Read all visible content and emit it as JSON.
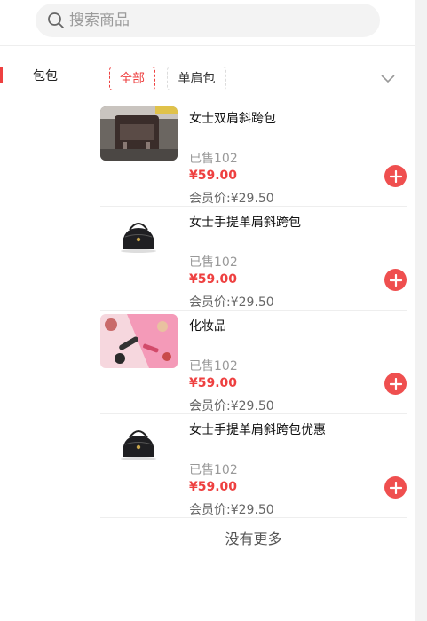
{
  "search": {
    "placeholder": "搜索商品"
  },
  "sidebar": {
    "items": [
      {
        "label": "包包",
        "active": true
      }
    ]
  },
  "filters": {
    "chips": [
      {
        "label": "全部",
        "active": true
      },
      {
        "label": "单肩包",
        "active": false
      }
    ]
  },
  "products": [
    {
      "title": "女士双肩斜跨包",
      "sold": "已售102",
      "price": "¥59.00",
      "member_price": "会员价:¥29.50",
      "image": "backpack"
    },
    {
      "title": "女士手提单肩斜跨包",
      "sold": "已售102",
      "price": "¥59.00",
      "member_price": "会员价:¥29.50",
      "image": "handbag"
    },
    {
      "title": "化妆品",
      "sold": "已售102",
      "price": "¥59.00",
      "member_price": "会员价:¥29.50",
      "image": "cosmetics"
    },
    {
      "title": "女士手提单肩斜跨包优惠",
      "sold": "已售102",
      "price": "¥59.00",
      "member_price": "会员价:¥29.50",
      "image": "handbag"
    }
  ],
  "footer": {
    "no_more": "没有更多"
  },
  "colors": {
    "accent": "#ee4040",
    "add_button": "#ef4f4f",
    "search_bg": "#f3f3f3"
  },
  "icons": {
    "search": "search-icon",
    "expand": "chevron-down-icon",
    "add": "plus-circle-icon"
  }
}
